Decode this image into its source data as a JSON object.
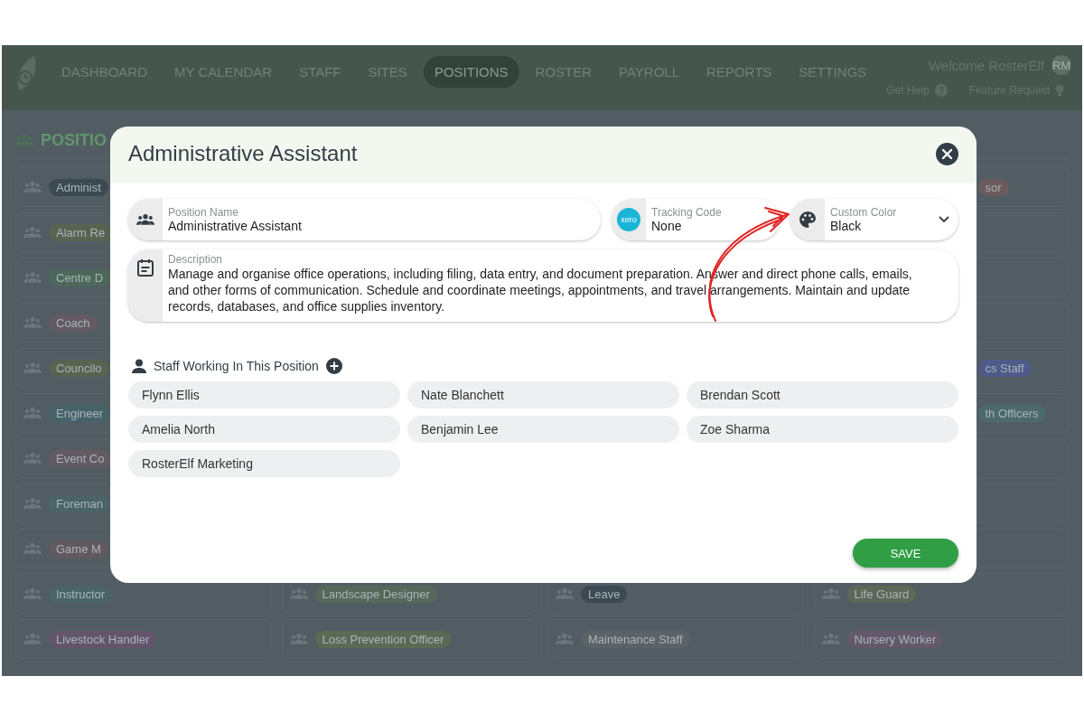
{
  "nav": {
    "items": [
      {
        "label": "DASHBOARD",
        "selected": false
      },
      {
        "label": "MY CALENDAR",
        "selected": false
      },
      {
        "label": "STAFF",
        "selected": false
      },
      {
        "label": "SITES",
        "selected": false
      },
      {
        "label": "POSITIONS",
        "selected": true
      },
      {
        "label": "ROSTER",
        "selected": false
      },
      {
        "label": "PAYROLL",
        "selected": false
      },
      {
        "label": "REPORTS",
        "selected": false
      },
      {
        "label": "SETTINGS",
        "selected": false
      }
    ],
    "welcome": "Welcome RosterElf",
    "avatar": "RM",
    "help": "Get Help",
    "feature": "Feature Request"
  },
  "page": {
    "title": "POSITIO",
    "rows": [
      [
        {
          "kind": "tag",
          "label": "Administ",
          "color": "#3c4952"
        },
        {
          "kind": "empty"
        },
        {
          "kind": "empty"
        },
        {
          "kind": "tail",
          "label": "sor",
          "color": "#6c5a5c"
        }
      ],
      [
        {
          "kind": "tag",
          "label": "Alarm Re",
          "color": "#5a6352"
        },
        {
          "kind": "empty"
        },
        {
          "kind": "empty"
        },
        {
          "kind": "empty"
        }
      ],
      [
        {
          "kind": "tag",
          "label": "Centre D",
          "color": "#4d685a"
        },
        {
          "kind": "empty"
        },
        {
          "kind": "empty"
        },
        {
          "kind": "empty"
        }
      ],
      [
        {
          "kind": "tag",
          "label": "Coach",
          "color": "#635a62"
        },
        {
          "kind": "empty"
        },
        {
          "kind": "empty"
        },
        {
          "kind": "empty"
        }
      ],
      [
        {
          "kind": "tag",
          "label": "Councilo",
          "color": "#596350"
        },
        {
          "kind": "empty"
        },
        {
          "kind": "empty"
        },
        {
          "kind": "tail",
          "label": "cs Staff",
          "color": "#4f5a8a"
        }
      ],
      [
        {
          "kind": "tag",
          "label": "Engineer",
          "color": "#47636a"
        },
        {
          "kind": "empty"
        },
        {
          "kind": "empty"
        },
        {
          "kind": "tail",
          "label": "th Officers",
          "color": "#4c696b"
        }
      ],
      [
        {
          "kind": "tag",
          "label": "Event Co",
          "color": "#635a62"
        },
        {
          "kind": "empty"
        },
        {
          "kind": "empty"
        },
        {
          "kind": "empty"
        }
      ],
      [
        {
          "kind": "tag",
          "label": "Foreman",
          "color": "#4a6468"
        },
        {
          "kind": "empty"
        },
        {
          "kind": "empty"
        },
        {
          "kind": "empty"
        }
      ],
      [
        {
          "kind": "tag",
          "label": "Game M",
          "color": "#62595f"
        },
        {
          "kind": "empty"
        },
        {
          "kind": "empty"
        },
        {
          "kind": "empty"
        }
      ],
      [
        {
          "kind": "tag",
          "label": "Instructor",
          "color": "#4a6468"
        },
        {
          "kind": "tag",
          "label": "Landscape Designer",
          "color": "#55685a"
        },
        {
          "kind": "tag",
          "label": "Leave",
          "color": "#3c4952"
        },
        {
          "kind": "tag",
          "label": "Life Guard",
          "color": "#5e6758"
        }
      ],
      [
        {
          "kind": "tag",
          "label": "Livestock Handler",
          "color": "#63566a"
        },
        {
          "kind": "tag",
          "label": "Loss Prevention Officer",
          "color": "#5c6a55"
        },
        {
          "kind": "tag",
          "label": "Maintenance Staff",
          "color": "#5b6367"
        },
        {
          "kind": "tag",
          "label": "Nursery Worker",
          "color": "#64596b"
        }
      ]
    ]
  },
  "modal": {
    "title": "Administrative Assistant",
    "fields": [
      {
        "kind": "people",
        "label": "Position Name",
        "value": "Administrative Assistant"
      },
      {
        "kind": "xero",
        "label": "Tracking Code",
        "value": "None",
        "logo": "xero"
      },
      {
        "kind": "color",
        "label": "Custom Color",
        "value": "Black"
      }
    ],
    "description": {
      "label": "Description",
      "value": "Manage and organise office operations, including filing, data entry, and document preparation. Answer and direct phone calls, emails, and other forms of communication. Schedule and coordinate meetings, appointments, and travel arrangements. Maintain and update records, databases, and office supplies inventory."
    },
    "staff_heading": "Staff Working In This Position",
    "staff": [
      "Flynn Ellis",
      "Nate Blanchett",
      "Brendan Scott",
      "Amelia North",
      "Benjamin Lee",
      "Zoe Sharma",
      "RosterElf Marketing"
    ],
    "save": "SAVE"
  }
}
